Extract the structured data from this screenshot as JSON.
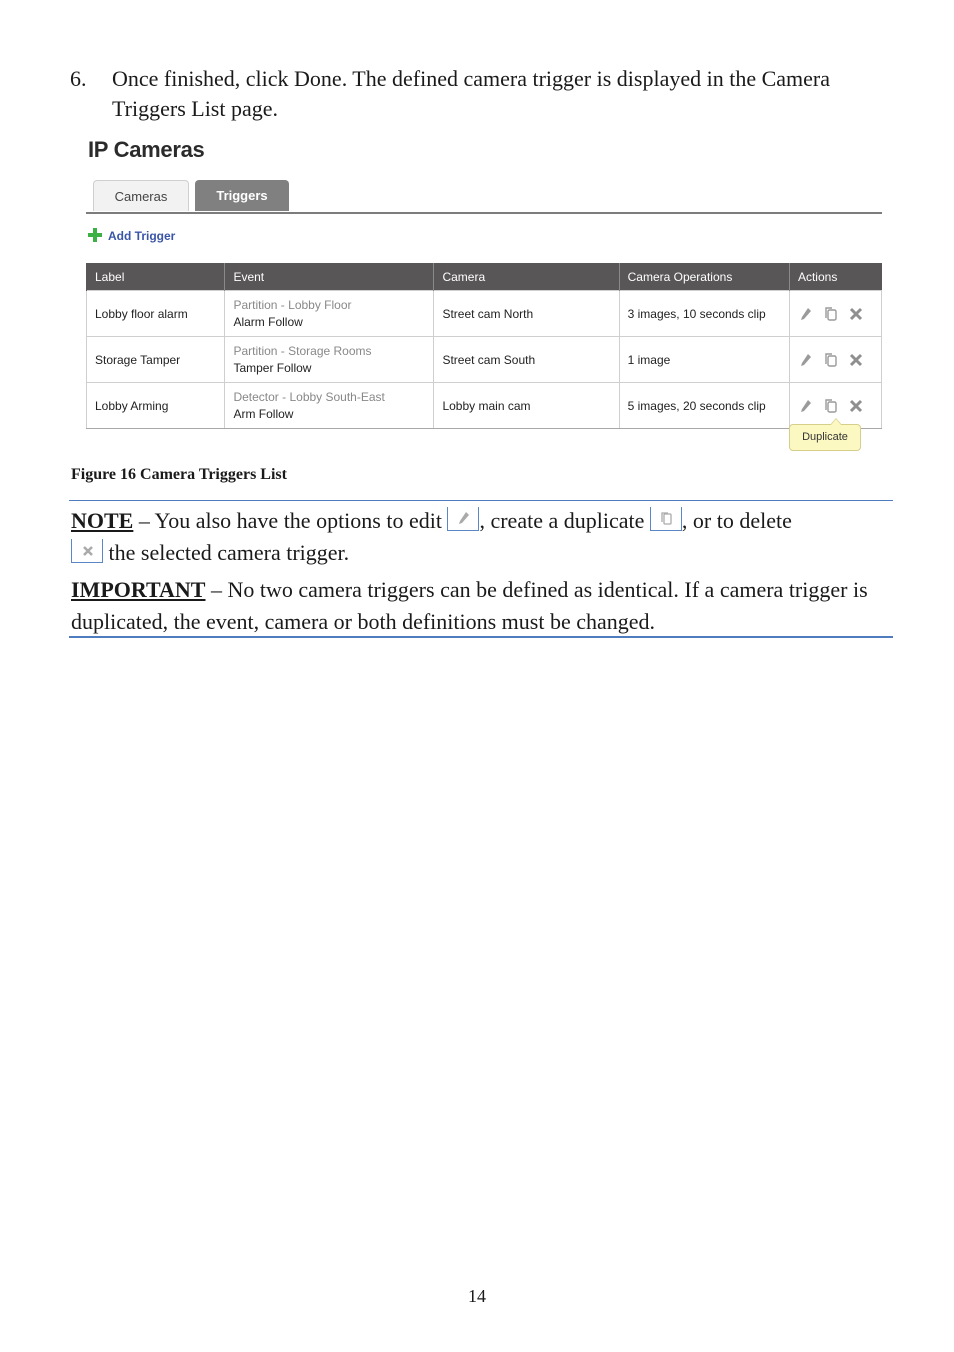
{
  "step": {
    "number": "6.",
    "text": "Once finished, click Done. The defined camera trigger is displayed in the Camera Triggers List page."
  },
  "figure": {
    "title": "IP Cameras",
    "tabs": [
      {
        "label": "Cameras",
        "active": false
      },
      {
        "label": "Triggers",
        "active": true
      }
    ],
    "add_trigger": {
      "icon": "plus-icon",
      "label": "Add Trigger"
    },
    "table": {
      "columns": [
        "Label",
        "Event",
        "Camera",
        "Camera Operations",
        "Actions"
      ],
      "rows": [
        {
          "label": "Lobby floor alarm",
          "event_source": "Partition - Lobby Floor",
          "event_type": "Alarm Follow",
          "camera": "Street cam North",
          "operations": "3 images, 10 seconds clip"
        },
        {
          "label": "Storage Tamper",
          "event_source": "Partition - Storage Rooms",
          "event_type": "Tamper Follow",
          "camera": "Street cam South",
          "operations": "1 image"
        },
        {
          "label": "Lobby Arming",
          "event_source": "Detector - Lobby South-East",
          "event_type": "Arm Follow",
          "camera": "Lobby main cam",
          "operations": "5 images, 20 seconds clip"
        }
      ],
      "action_icons": [
        "edit-icon",
        "duplicate-icon",
        "delete-icon"
      ]
    },
    "tooltip": "Duplicate"
  },
  "caption": "Figure 16 Camera Triggers List",
  "note": {
    "keyword": "NOTE",
    "part1": " – You also have the options to edit ",
    "part2": ", create a duplicate ",
    "part3": ", or to delete ",
    "part4": " the selected camera trigger."
  },
  "important": {
    "keyword": "IMPORTANT",
    "text": " – No two camera triggers can be defined as identical. If a camera trigger is duplicated, the event, camera or both definitions must be changed."
  },
  "page_number": "14",
  "colors": {
    "header_bg": "#585656",
    "active_tab": "#808080",
    "link": "#3a55a8",
    "plus": "#3cb044",
    "tooltip_bg": "#fcf8c2",
    "rule": "#4f7bbf"
  }
}
